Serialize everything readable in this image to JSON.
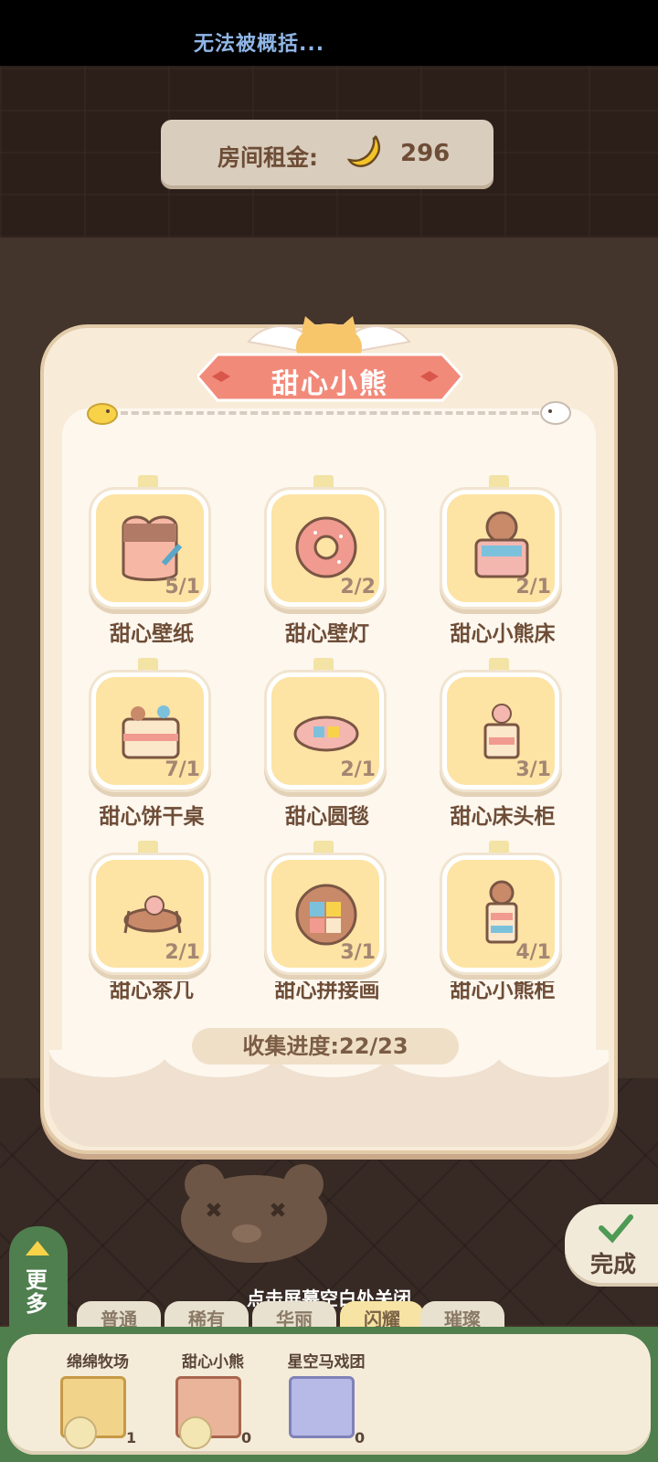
{
  "status_bar": {
    "title": "无法被概括..."
  },
  "rent": {
    "label": "房间租金:",
    "currency_icon": "banana-icon",
    "amount": "296"
  },
  "set_card": {
    "title": "甜心小熊",
    "items": [
      {
        "name": "甜心壁纸",
        "count": "5/1",
        "icon": "wallpaper-icon"
      },
      {
        "name": "甜心壁灯",
        "count": "2/2",
        "icon": "donut-lamp-icon"
      },
      {
        "name": "甜心小熊床",
        "count": "2/1",
        "icon": "bear-bed-icon"
      },
      {
        "name": "甜心饼干桌",
        "count": "7/1",
        "icon": "cake-table-icon"
      },
      {
        "name": "甜心圆毯",
        "count": "2/1",
        "icon": "round-rug-icon"
      },
      {
        "name": "甜心床头柜",
        "count": "3/1",
        "icon": "nightstand-icon"
      },
      {
        "name": "甜心茶几",
        "count": "2/1",
        "icon": "tea-table-icon"
      },
      {
        "name": "甜心拼接画",
        "count": "3/1",
        "icon": "patchwork-painting-icon"
      },
      {
        "name": "甜心小熊柜",
        "count": "4/1",
        "icon": "bear-cabinet-icon"
      }
    ],
    "progress": "收集进度:22/23"
  },
  "done_button": {
    "label": "完成"
  },
  "more_button": {
    "label": "更多"
  },
  "close_hint": "点击屏幕空白处关闭",
  "rarity_tabs": [
    {
      "label": "普通"
    },
    {
      "label": "稀有"
    },
    {
      "label": "华丽"
    },
    {
      "label": "闪耀"
    },
    {
      "label": "璀璨"
    }
  ],
  "collections": [
    {
      "label": "绵绵牧场",
      "count": "1"
    },
    {
      "label": "甜心小熊",
      "count": "0"
    },
    {
      "label": "星空马戏团",
      "count": "0"
    }
  ],
  "colors": {
    "accent_ribbon": "#f28a7a",
    "tile": "#fde3a4",
    "tray_green": "#4e7f4c"
  }
}
